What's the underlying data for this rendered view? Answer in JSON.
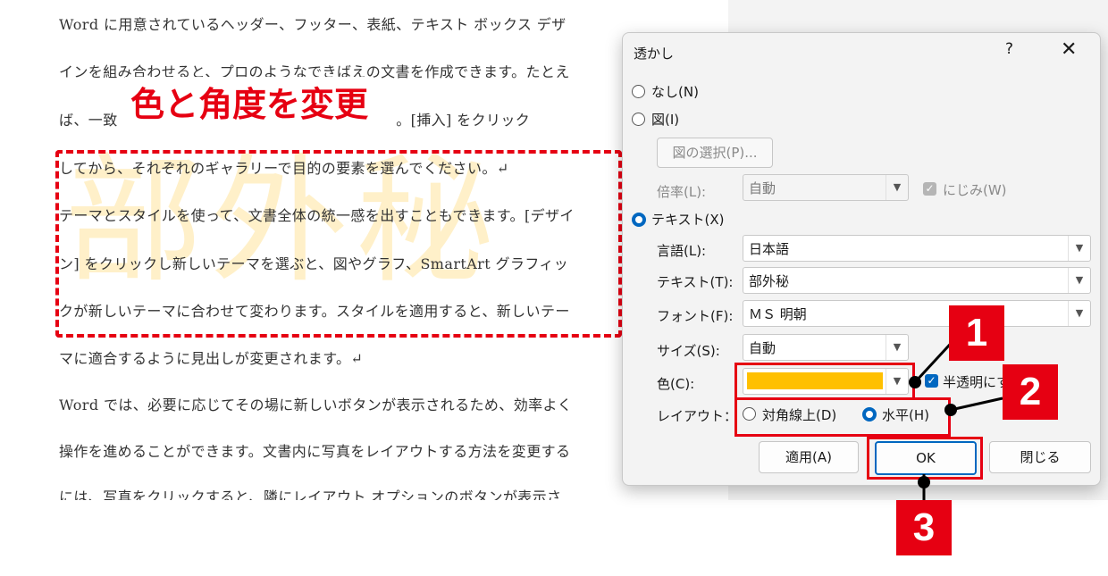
{
  "document": {
    "lines": [
      "Word に用意されているヘッダー、フッター、表紙、テキスト ボックス デザ",
      "インを組み合わせると、プロのようなできばえの文書を作成できます。たとえ",
      "ば、一致　　　　　　　　　　　　　　　　　　　。[挿入] をクリック",
      "してから、それぞれのギャラリーで目的の要素を選んでください。↵",
      "テーマとスタイルを使って、文書全体の統一感を出すこともできます。[デザイ",
      "ン] をクリックし新しいテーマを選ぶと、図やグラフ、SmartArt グラフィッ",
      "クが新しいテーマに合わせて変わります。スタイルを適用すると、新しいテー",
      "マに適合するように見出しが変更されます。↵",
      "Word では、必要に応じてその場に新しいボタンが表示されるため、効率よく",
      "操作を進めることができます。文書内に写真をレイアウトする方法を変更する",
      "には、写真をクリックすると、隣にレイアウト オプションのボタンが表示さ"
    ],
    "watermark": "部外秘",
    "heading": "色と角度を変更"
  },
  "dialog": {
    "title": "透かし",
    "help": "?",
    "close": "✕",
    "opt_none": "なし(N)",
    "opt_picture": "図(I)",
    "select_picture": "図の選択(P)...",
    "scale_label": "倍率(L):",
    "scale_value": "自動",
    "washout_label": "にじみ(W)",
    "opt_text": "テキスト(X)",
    "language_label": "言語(L):",
    "language_value": "日本語",
    "text_label": "テキスト(T):",
    "text_value": "部外秘",
    "font_label": "フォント(F):",
    "font_value": "ＭＳ 明朝",
    "size_label": "サイズ(S):",
    "size_value": "自動",
    "color_label": "色(C):",
    "color_value": "#ffc000",
    "semitransparent_label": "半透明にする",
    "layout_label": "レイアウト：",
    "layout_diagonal": "対角線上(D)",
    "layout_horizontal": "水平(H)",
    "apply": "適用(A)",
    "ok": "OK",
    "close_button": "閉じる"
  },
  "callouts": [
    "1",
    "2",
    "3"
  ],
  "colors": {
    "accent": "#0067c0",
    "callout_red": "#e60012"
  }
}
